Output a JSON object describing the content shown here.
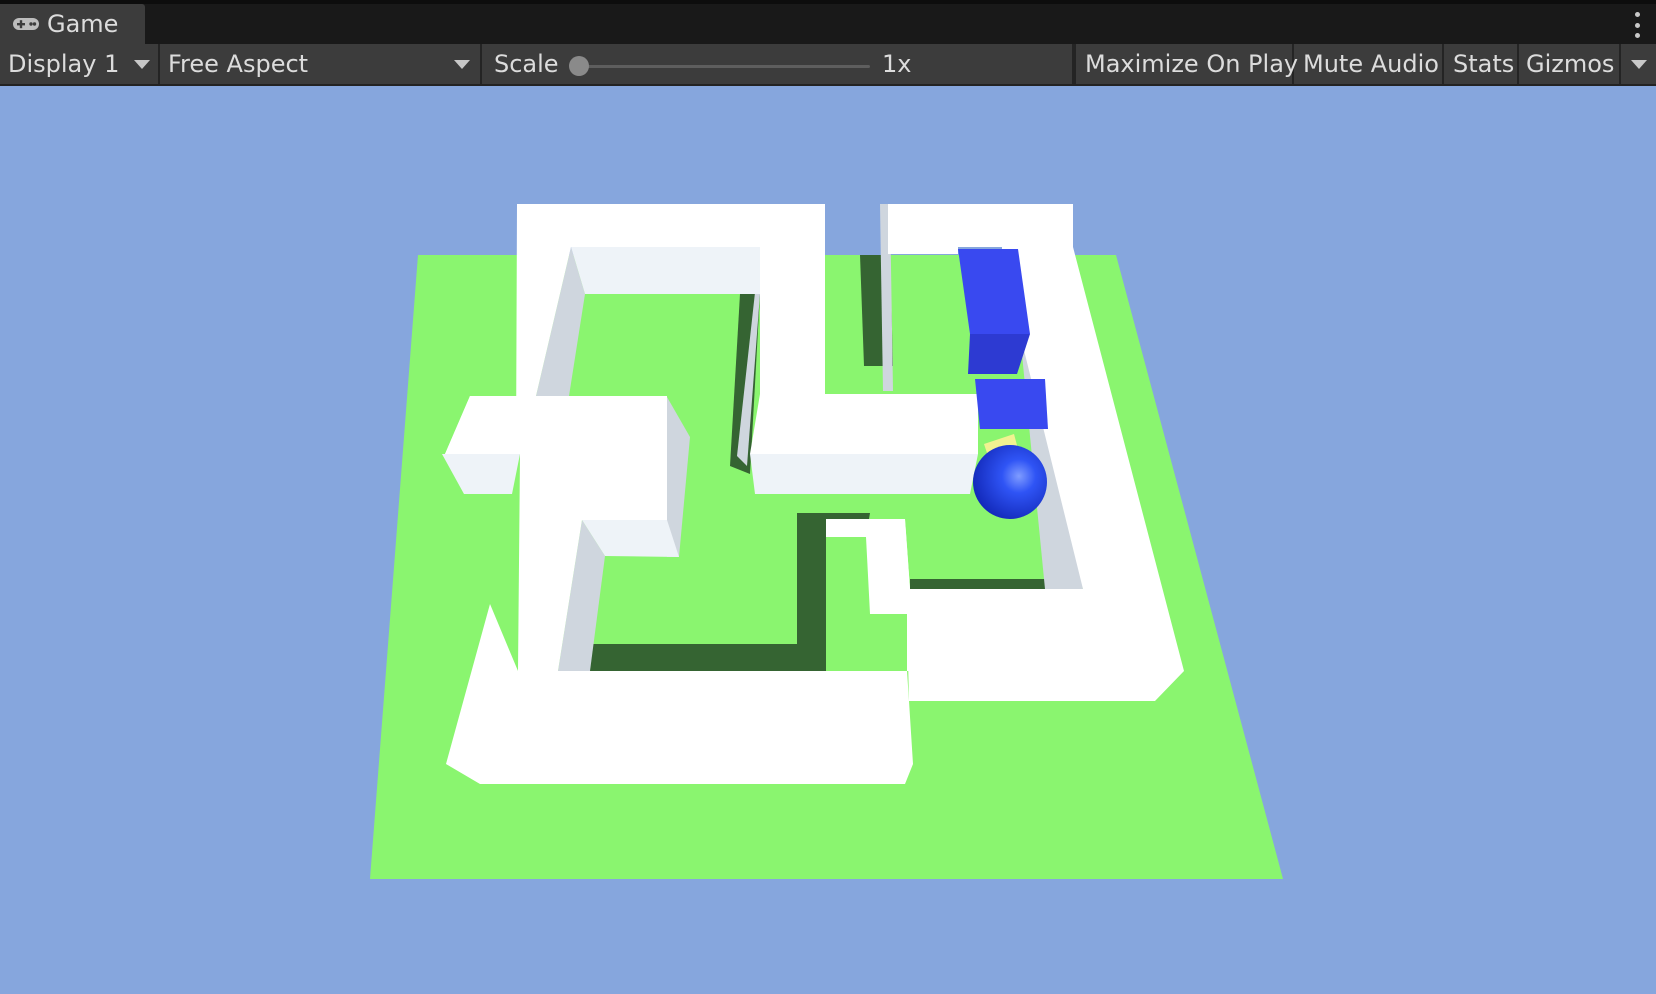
{
  "window": {
    "tab_label": "Game",
    "tab_icon": "gamepad-icon",
    "menu_icon": "kebab-menu-icon"
  },
  "toolbar": {
    "display_label": "Display 1",
    "aspect_label": "Free Aspect",
    "scale_label": "Scale",
    "scale_value": "1x",
    "maximize_label": "Maximize On Play",
    "mute_label": "Mute Audio",
    "stats_label": "Stats",
    "gizmos_label": "Gizmos"
  },
  "viewport": {
    "sky_color": "#86a6dd",
    "ground_color": "#8af56f",
    "wall_color": "#ffffff",
    "player_color": "#2c43ec",
    "ball_color": "#1a3de8",
    "marker_color": "#f1f291"
  }
}
